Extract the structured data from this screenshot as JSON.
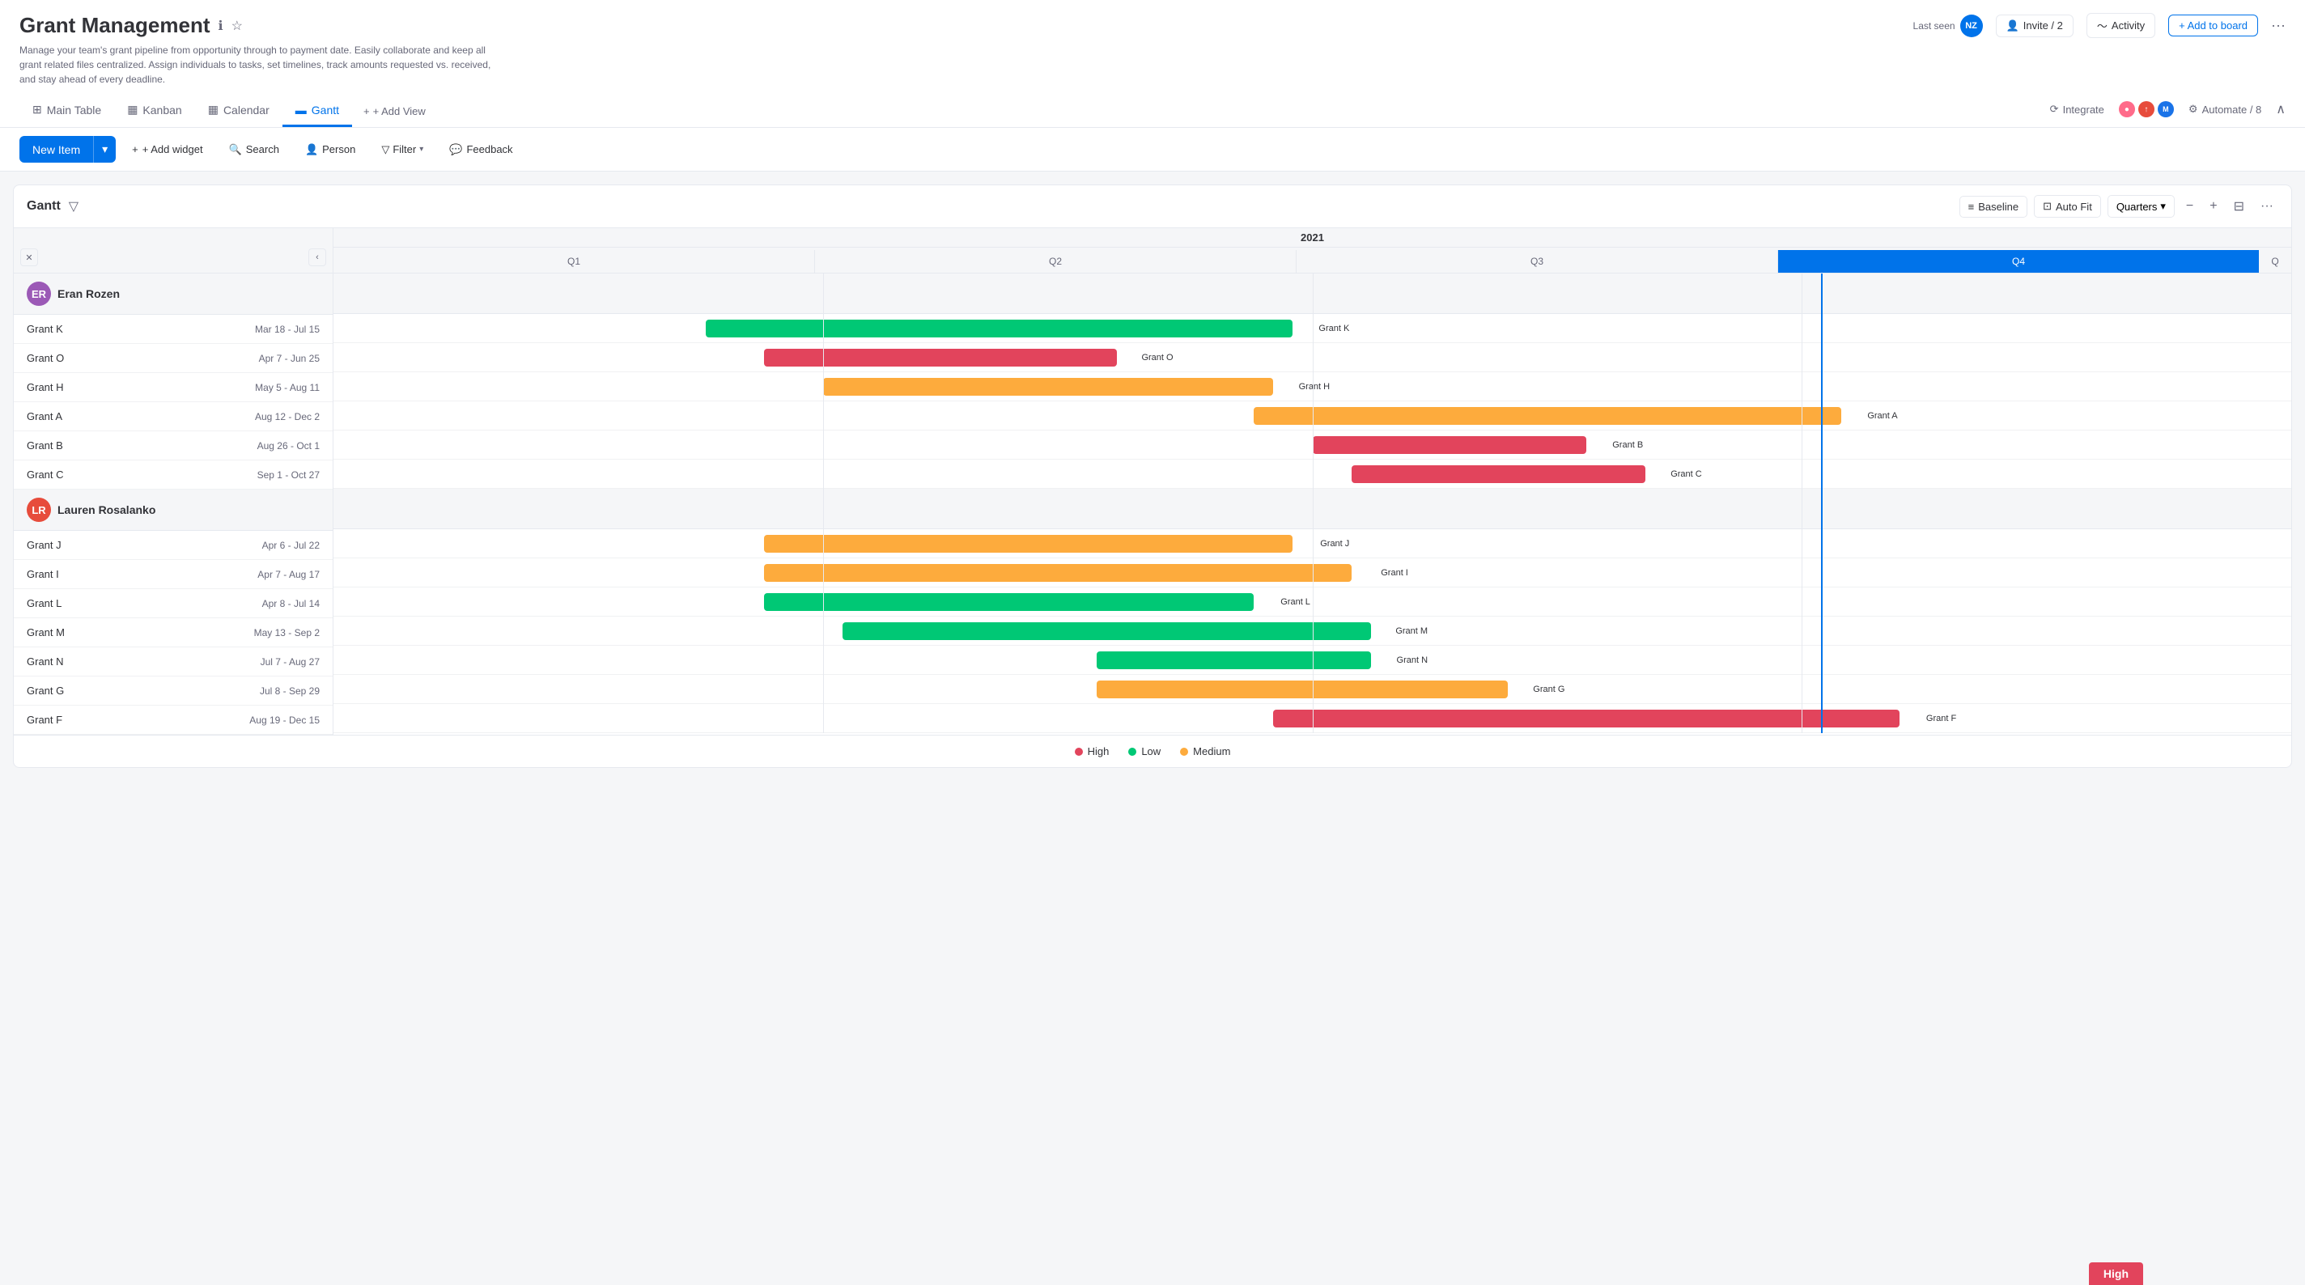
{
  "app": {
    "title": "Grant Management",
    "description": "Manage your team's grant pipeline from opportunity through to payment date. Easily collaborate and keep all grant related files centralized. Assign individuals to tasks, set timelines, track amounts requested vs. received, and stay ahead of every deadline."
  },
  "header": {
    "last_seen_label": "Last seen",
    "invite_label": "Invite / 2",
    "activity_label": "Activity",
    "add_board_label": "+ Add to board",
    "avatar_initials": "NZ"
  },
  "tabs": [
    {
      "id": "main-table",
      "label": "Main Table",
      "icon": "⊞"
    },
    {
      "id": "kanban",
      "label": "Kanban",
      "icon": "▦"
    },
    {
      "id": "calendar",
      "label": "Calendar",
      "icon": "📅"
    },
    {
      "id": "gantt",
      "label": "Gantt",
      "icon": "📊",
      "active": true
    },
    {
      "id": "add-view",
      "label": "+ Add View",
      "icon": ""
    }
  ],
  "toolbar_right": {
    "integrate_label": "Integrate",
    "automate_label": "Automate / 8"
  },
  "toolbar": {
    "new_item_label": "New Item",
    "add_widget_label": "+ Add widget",
    "search_label": "Search",
    "person_label": "Person",
    "filter_label": "Filter",
    "feedback_label": "Feedback"
  },
  "gantt": {
    "title": "Gantt",
    "baseline_label": "Baseline",
    "auto_fit_label": "Auto Fit",
    "quarters_label": "Quarters",
    "year": "2021",
    "quarters": [
      "Q1",
      "Q2",
      "Q3",
      "Q4"
    ],
    "current_quarter": "Q4",
    "today_position_pct": 73
  },
  "groups": [
    {
      "id": "eran",
      "name": "Eran Rozen",
      "avatar_initials": "ER",
      "grants": [
        {
          "name": "Grant K",
          "dates": "Mar 18 - Jul 15",
          "color": "green",
          "start_pct": 19,
          "width_pct": 30,
          "label": "Grant K"
        },
        {
          "name": "Grant O",
          "dates": "Apr 7 - Jun 25",
          "color": "red",
          "start_pct": 22,
          "width_pct": 18,
          "label": "Grant O"
        },
        {
          "name": "Grant H",
          "dates": "May 5 - Aug 11",
          "color": "orange",
          "start_pct": 25,
          "width_pct": 22,
          "label": "Grant H"
        },
        {
          "name": "Grant A",
          "dates": "Aug 12 - Dec 2",
          "color": "orange",
          "start_pct": 47,
          "width_pct": 29,
          "label": "Grant A"
        },
        {
          "name": "Grant B",
          "dates": "Aug 26 - Oct 1",
          "color": "red",
          "start_pct": 50,
          "width_pct": 14,
          "label": "Grant B"
        },
        {
          "name": "Grant C",
          "dates": "Sep 1 - Oct 27",
          "color": "red",
          "start_pct": 52,
          "width_pct": 15,
          "label": "Grant C"
        }
      ]
    },
    {
      "id": "lauren",
      "name": "Lauren Rosalanko",
      "avatar_initials": "LR",
      "grants": [
        {
          "name": "Grant J",
          "dates": "Apr 6 - Jul 22",
          "color": "orange",
          "start_pct": 22,
          "width_pct": 27,
          "label": "Grant J"
        },
        {
          "name": "Grant I",
          "dates": "Apr 7 - Aug 17",
          "color": "orange",
          "start_pct": 22,
          "width_pct": 30,
          "label": "Grant I"
        },
        {
          "name": "Grant L",
          "dates": "Apr 8 - Jul 14",
          "color": "green",
          "start_pct": 22,
          "width_pct": 25,
          "label": "Grant L"
        },
        {
          "name": "Grant M",
          "dates": "May 13 - Sep 2",
          "color": "green",
          "start_pct": 26,
          "width_pct": 27,
          "label": "Grant M"
        },
        {
          "name": "Grant N",
          "dates": "Jul 7 - Aug 27",
          "color": "green",
          "start_pct": 39,
          "width_pct": 14,
          "label": "Grant N"
        },
        {
          "name": "Grant G",
          "dates": "Jul 8 - Sep 29",
          "color": "orange",
          "start_pct": 39,
          "width_pct": 21,
          "label": "Grant G"
        },
        {
          "name": "Grant F",
          "dates": "Aug 19 - Dec 15",
          "color": "red",
          "start_pct": 48,
          "width_pct": 30,
          "label": "Grant F"
        }
      ]
    }
  ],
  "legend": [
    {
      "label": "High",
      "color": "red"
    },
    {
      "label": "Low",
      "color": "green"
    },
    {
      "label": "Medium",
      "color": "orange"
    }
  ],
  "high_badge": "High"
}
